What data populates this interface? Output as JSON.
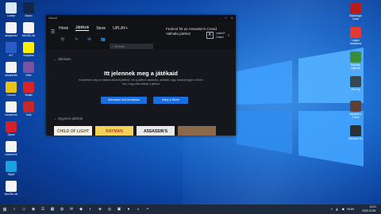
{
  "desktop": {
    "left_icons": [
      {
        "label": "Lomtár",
        "color": "#d9e8f7"
      },
      {
        "label": "szoqaw.lnk",
        "color": "#f4f4f4"
      },
      {
        "label": "IKT",
        "color": "#2a5cc7"
      },
      {
        "label": "szoqaw.lnk",
        "color": "#f4f4f4"
      },
      {
        "label": "Chrome",
        "color": "#e8c31a"
      },
      {
        "label": "hoszek.lnk",
        "color": "#f4f4f4"
      },
      {
        "label": "Opera",
        "color": "#d3202b"
      },
      {
        "label": "hoszek.lnk",
        "color": "#f4f4f4"
      },
      {
        "label": "Skype",
        "color": "#1aa1e0"
      },
      {
        "label": "fotoCBL.lnk",
        "color": "#f4f4f4"
      },
      {
        "label": "Steam",
        "color": "#12284a"
      },
      {
        "label": "fotoCBL.lnk",
        "color": "#f4f4f4"
      },
      {
        "label": "Snapchat",
        "color": "#fff000"
      },
      {
        "label": "Viber",
        "color": "#7b51a3"
      },
      {
        "label": "Vivaldi",
        "color": "#d9232a"
      },
      {
        "label": "Tools",
        "color": "#c62828"
      }
    ],
    "right_icons": [
      {
        "label": "Watchdogs Crack",
        "color": "#b71c1c"
      },
      {
        "label": "Legion Assassins",
        "color": "#e53935"
      },
      {
        "label": "Rayman Legends",
        "color": "#388e3c"
      },
      {
        "label": "Far Cry",
        "color": "#37474f"
      },
      {
        "label": "Assassin's Creed",
        "color": "#5d4037"
      },
      {
        "label": "Rainbow Six",
        "color": "#263238"
      }
    ]
  },
  "window": {
    "title": "Ubisoft",
    "controls": [
      "–",
      "□",
      "✕"
    ],
    "nav": {
      "home": "Hírek",
      "games": "Játékok",
      "store": "Store",
      "uplay": "UPLAY+"
    },
    "promo": "Fedezd fel az Assassin's Creed Valhalla játékot",
    "search_placeholder": "Keresés",
    "user": {
      "initial": "K",
      "name": "csabi4T",
      "status": "Online",
      "points": "0"
    },
    "section_mine": "Játékaim",
    "empty_title": "Itt jelennek meg a játékaid",
    "empty_sub": "Itt jelennek meg az általad vásárolt játékok. Ha új játékot vásárolsz, aktiváld, vagy vásárolj egyet a Store-ban, hogy elkezdhesd a játékot.",
    "btn_activate": "Aktiválási kód beváltása",
    "btn_store": "Irány a Store",
    "section_free": "Ingyenes játékok",
    "games": [
      {
        "title": "CHILD OF LIGHT",
        "bg": "#f1efe7",
        "fg": "#6b5a3a"
      },
      {
        "title": "RAYMAN",
        "bg": "#f3d25a",
        "fg": "#c0392b"
      },
      {
        "title": "ASSASSIN'S",
        "bg": "#e9e9e9",
        "fg": "#111111"
      },
      {
        "title": "",
        "bg": "#8a6a4a",
        "fg": "#ffffff"
      }
    ]
  },
  "taskbar": {
    "time": "13:01",
    "date": "2020.12.05.",
    "lang": "HUN",
    "apps": [
      "▭",
      "◉",
      "☰",
      "▦",
      "◍",
      "✉",
      "◆",
      "◐",
      "◈",
      "◎",
      "▣",
      "●",
      "◒",
      "◓"
    ]
  }
}
